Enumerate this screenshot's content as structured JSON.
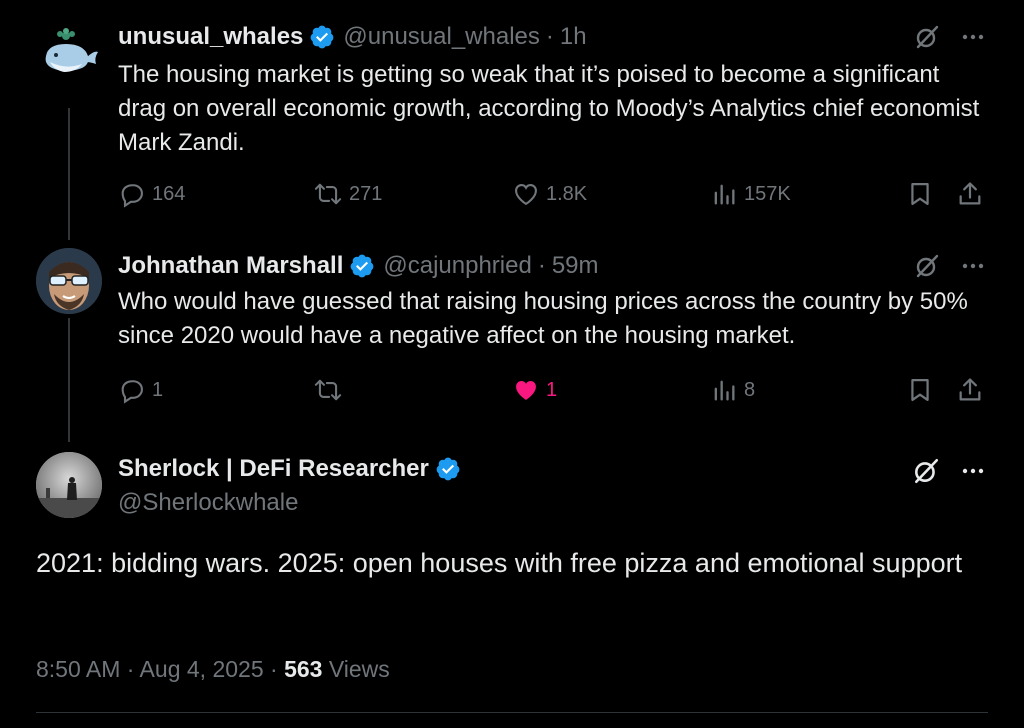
{
  "colors": {
    "background": "#000000",
    "text_primary": "#e7e9ea",
    "text_secondary": "#71767b",
    "verified_blue": "#1d9bf0",
    "like_pink": "#f91880"
  },
  "tweets": [
    {
      "display_name": "unusual_whales",
      "handle": "@unusual_whales",
      "separator": "·",
      "time": "1h",
      "text": "The housing market is getting so weak that it’s poised to become a significant drag on overall economic growth, according to Moody’s Analytics chief economist Mark Zandi.",
      "replies": "164",
      "reposts": "271",
      "likes": "1.8K",
      "views": "157K",
      "avatar_icon": "whale-avatar"
    },
    {
      "display_name": "Johnathan Marshall",
      "handle": "@cajunphried",
      "separator": "·",
      "time": "59m",
      "text": "Who would have guessed that raising housing prices across the country by 50% since 2020 would have a negative affect on the housing market.",
      "replies": "1",
      "reposts": "",
      "likes": "1",
      "views": "8",
      "liked": true,
      "avatar_icon": "sunglasses-man-avatar"
    }
  ],
  "focal": {
    "display_name": "Sherlock | DeFi Researcher",
    "handle": "@Sherlockwhale",
    "text": "2021: bidding wars. 2025: open houses with free pizza and emotional support",
    "timestamp": "8:50 AM · Aug 4, 2025 · ",
    "views_count": "563",
    "views_label": " Views",
    "avatar_icon": "silhouette-avatar"
  },
  "icons": {
    "reply": "reply-icon",
    "repost": "repost-icon",
    "like": "heart-icon",
    "views": "views-icon",
    "bookmark": "bookmark-icon",
    "share": "share-icon",
    "grok": "grok-icon",
    "more": "more-icon"
  }
}
